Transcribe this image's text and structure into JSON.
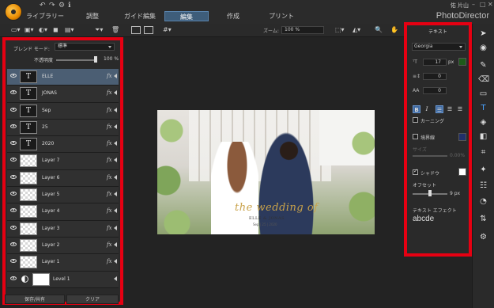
{
  "app": {
    "brand": "PhotoDirector",
    "user": "佑 片山"
  },
  "nav": {
    "tabs": [
      "ライブラリー",
      "調整",
      "ガイド編集",
      "編集",
      "作成",
      "プリント"
    ],
    "active": "編集"
  },
  "toolbar": {
    "zoom_label": "ズーム:",
    "zoom_value": "100 %"
  },
  "layer_panel": {
    "blend_label": "ブレンド モード:",
    "blend_value": "標準",
    "opacity_label": "不透明度",
    "opacity_value": "100 %",
    "opacity_level": 1.0,
    "layers": [
      {
        "name": "ELLE",
        "kind": "text",
        "thumb": "T",
        "selected": true
      },
      {
        "name": "JONAS",
        "kind": "text",
        "thumb": "T"
      },
      {
        "name": "Sep",
        "kind": "text",
        "thumb": "T"
      },
      {
        "name": "25",
        "kind": "text",
        "thumb": "T"
      },
      {
        "name": "2020",
        "kind": "text",
        "thumb": "T"
      },
      {
        "name": "Layer 7",
        "kind": "image"
      },
      {
        "name": "Layer 6",
        "kind": "image"
      },
      {
        "name": "Layer 5",
        "kind": "image"
      },
      {
        "name": "Layer 4",
        "kind": "image"
      },
      {
        "name": "Layer 3",
        "kind": "image"
      },
      {
        "name": "Layer 2",
        "kind": "image"
      },
      {
        "name": "Layer 1",
        "kind": "image"
      },
      {
        "name": "Level 1",
        "kind": "adjust"
      }
    ],
    "fx_label": "fx",
    "save_share": "保存/共有",
    "clear": "クリア"
  },
  "canvas": {
    "title": "the wedding of",
    "names": "ELLE & JONAS",
    "date": "Sep | 25 | 2020"
  },
  "text_panel": {
    "title": "テキスト",
    "font_family": "Georgia",
    "font_size": "17",
    "font_unit": "px",
    "font_color": "#1d5a1a",
    "line_spacing": "0",
    "char_spacing": "0",
    "kerning_label": "カーニング",
    "border_label": "境界線",
    "border_color": "#22306a",
    "size_label": "サイズ",
    "size_value": "0.00%",
    "shadow_label": "シャドウ",
    "shadow_color": "#ffffff",
    "offset_label": "オフセット",
    "offset_value": "9 px",
    "effect_label": "テキスト エフェクト",
    "effect_sample": "abcde"
  },
  "tools": [
    "pointer-icon",
    "stamp-icon",
    "brush-icon",
    "eraser-icon",
    "rectangle-icon",
    "text-icon",
    "fill-icon",
    "gradient-icon",
    "crop-icon",
    "magic-wand-icon",
    "adjust-icon",
    "levels-icon",
    "flip-icon",
    "settings-icon"
  ]
}
